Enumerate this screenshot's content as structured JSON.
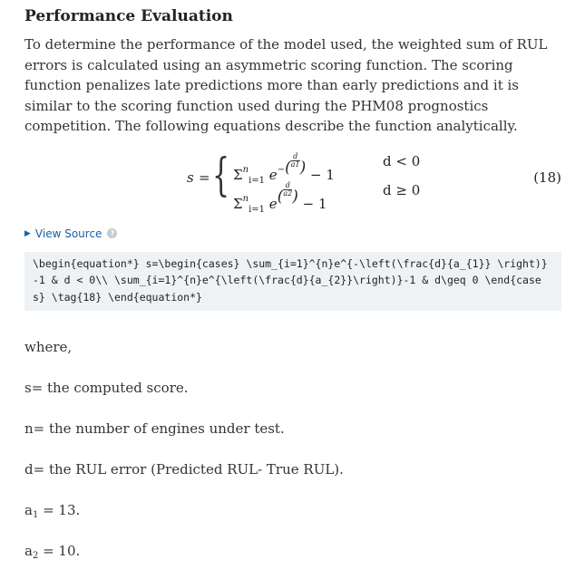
{
  "section": {
    "title": "Performance Evaluation",
    "paragraph": "To determine the performance of the model used, the weighted sum of RUL errors is calculated using an asymmetric scoring function. The scoring function penalizes late predictions more than early predictions and it is similar to the scoring function used during the PHM08 prognostics competition. The following equations describe the function analytically."
  },
  "equation": {
    "lhs": "s",
    "equals": "=",
    "sum_symbol": "Σ",
    "sum_lower": "i=1",
    "sum_upper": "n",
    "base": "e",
    "row1_exp_prefix": "−",
    "row1_frac_num": "d",
    "row1_frac_den": "a1",
    "row2_frac_num": "d",
    "row2_frac_den": "a2",
    "minus_one": "− 1",
    "cond1": "d < 0",
    "cond2": "d ≥ 0",
    "tag": "(18)"
  },
  "view_source": {
    "label": "View Source",
    "help_icon": "?"
  },
  "latex_source": "\\begin{equation*} s=\\begin{cases} \\sum_{i=1}^{n}e^{-\\left(\\frac{d}{a_{1}} \\right)}-1 & d < 0\\\\ \\sum_{i=1}^{n}e^{\\left(\\frac{d}{a_{2}}\\right)}-1 & d\\geq 0 \\end{cases} \\tag{18} \\end{equation*}",
  "definitions": {
    "where": "where,",
    "s_def": "s= the computed score.",
    "n_def": "n= the number of engines under test.",
    "d_def": "d= the RUL error (Predicted RUL- True RUL).",
    "a1_var": "a",
    "a1_sub": "1",
    "a1_val": " = 13.",
    "a2_var": "a",
    "a2_sub": "2",
    "a2_val": " = 10."
  }
}
